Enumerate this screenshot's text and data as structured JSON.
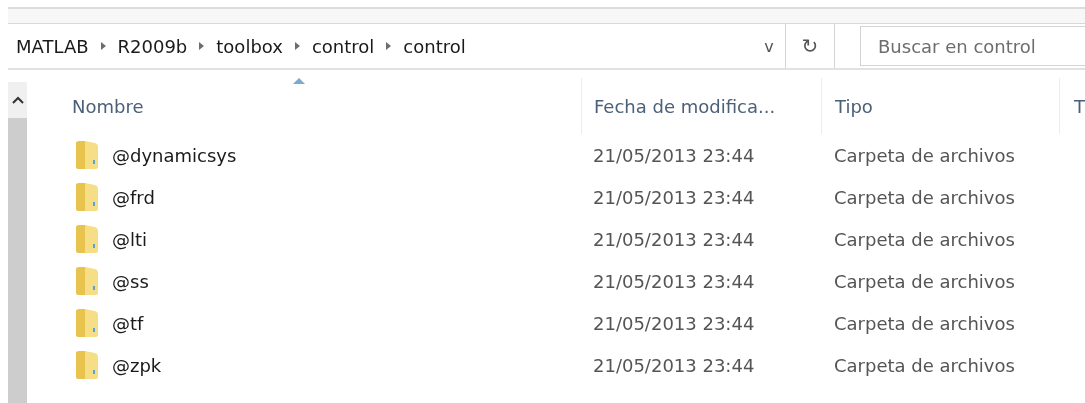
{
  "address_bar": {
    "breadcrumbs": [
      "MATLAB",
      "R2009b",
      "toolbox",
      "control",
      "control"
    ],
    "dropdown_icon": "v",
    "refresh_icon": "↻"
  },
  "search": {
    "placeholder": "Buscar en control"
  },
  "table": {
    "columns": [
      {
        "label": "Nombre",
        "sorted": true
      },
      {
        "label": "Fecha de modifica...",
        "sorted": false
      },
      {
        "label": "Tipo",
        "sorted": false
      },
      {
        "label": "T",
        "sorted": false
      }
    ],
    "rows": [
      {
        "name": "@dynamicsys",
        "date": "21/05/2013 23:44",
        "type": "Carpeta de archivos"
      },
      {
        "name": "@frd",
        "date": "21/05/2013 23:44",
        "type": "Carpeta de archivos"
      },
      {
        "name": "@lti",
        "date": "21/05/2013 23:44",
        "type": "Carpeta de archivos"
      },
      {
        "name": "@ss",
        "date": "21/05/2013 23:44",
        "type": "Carpeta de archivos"
      },
      {
        "name": "@tf",
        "date": "21/05/2013 23:44",
        "type": "Carpeta de archivos"
      },
      {
        "name": "@zpk",
        "date": "21/05/2013 23:44",
        "type": "Carpeta de archivos"
      }
    ]
  }
}
